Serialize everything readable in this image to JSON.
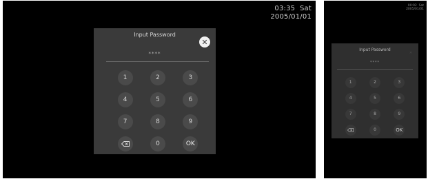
{
  "large": {
    "clock": {
      "time": "03:35",
      "weekday": "Sat",
      "date": "2005/01/01"
    },
    "dialog": {
      "title": "Input Password",
      "masked_value": "****",
      "close_icon": "close-icon",
      "keys": [
        "1",
        "2",
        "3",
        "4",
        "5",
        "6",
        "7",
        "8",
        "9",
        "backspace",
        "0",
        "OK"
      ]
    }
  },
  "small": {
    "clock": {
      "time": "00:02",
      "weekday": "Sat",
      "date": "2005/01/01"
    },
    "dialog": {
      "title": "Input Password",
      "masked_value": "****",
      "close_icon": "close-icon",
      "keys": [
        "1",
        "2",
        "3",
        "4",
        "5",
        "6",
        "7",
        "8",
        "9",
        "backspace",
        "0",
        "OK"
      ]
    }
  },
  "colors": {
    "screen": "#000000",
    "panel": "#3a3a3a",
    "key": "#4a4a4a",
    "close_button": "#f2f2f2"
  }
}
